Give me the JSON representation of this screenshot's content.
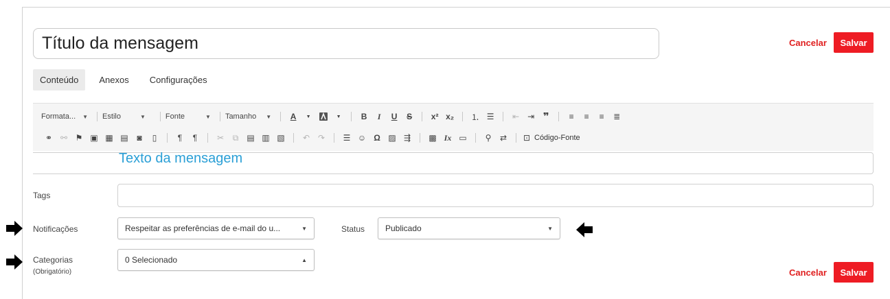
{
  "header": {
    "title_value": "Título da mensagem",
    "cancel_label": "Cancelar",
    "save_label": "Salvar"
  },
  "tabs": [
    {
      "label": "Conteúdo",
      "active": true
    },
    {
      "label": "Anexos",
      "active": false
    },
    {
      "label": "Configurações",
      "active": false
    }
  ],
  "toolbar": {
    "format_label": "Formata...",
    "style_label": "Estilo",
    "font_label": "Fonte",
    "size_label": "Tamanho",
    "source_label": "Código-Fonte"
  },
  "editor": {
    "content": "Texto da mensagem"
  },
  "form": {
    "tags_label": "Tags",
    "tags_value": "",
    "notifications_label": "Notificações",
    "notifications_value": "Respeitar as preferências de e-mail do u...",
    "status_label": "Status",
    "status_value": "Publicado",
    "categories_label": "Categorias",
    "categories_sub_label": "(Obrigatório)",
    "categories_value": "0 Selecionado"
  },
  "footer": {
    "cancel_label": "Cancelar",
    "save_label": "Salvar"
  },
  "colors": {
    "accent_red": "#ee1c24",
    "editor_text_blue": "#2a9fd6"
  }
}
